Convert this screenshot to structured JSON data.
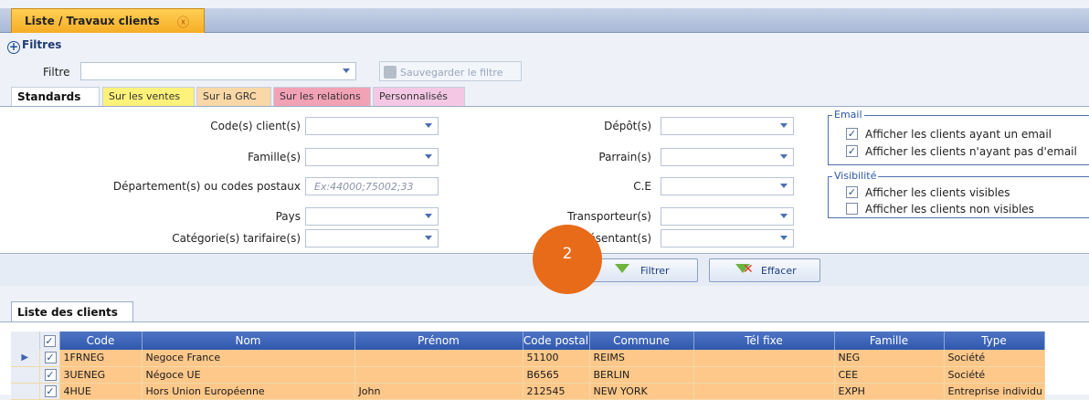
{
  "window": {
    "tab_label": "Liste / Travaux clients",
    "tab_close": "ⓧ"
  },
  "filters": {
    "title": "Filtres",
    "filter_label": "Filtre",
    "filter_value": "",
    "save_button": "Sauvegarder le filtre"
  },
  "subtabs": [
    {
      "label": "Standards",
      "color": "#ffffff"
    },
    {
      "label": "Sur les ventes",
      "color": "#fff27a"
    },
    {
      "label": "Sur la GRC",
      "color": "#f9d7a6"
    },
    {
      "label": "Sur les relations",
      "color": "#f2a2b5"
    },
    {
      "label": "Personnalisés",
      "color": "#f4c8e4"
    }
  ],
  "fields": {
    "code_client": "Code(s) client(s)",
    "famille": "Famille(s)",
    "departement": "Département(s) ou codes postaux",
    "departement_placeholder": "Ex:44000;75002;33",
    "pays": "Pays",
    "categorie": "Catégorie(s) tarifaire(s)",
    "depot": "Dépôt(s)",
    "parrain": "Parrain(s)",
    "ce": "C.E",
    "transporteur": "Transporteur(s)",
    "representant": "ésentant(s)"
  },
  "email_group": {
    "title": "Email",
    "opt1": "Afficher les clients ayant un email",
    "opt1_checked": true,
    "opt2": "Afficher les clients n'ayant pas d'email",
    "opt2_checked": true
  },
  "visibility_group": {
    "title": "Visibilité",
    "opt1": "Afficher les clients visibles",
    "opt1_checked": true,
    "opt2": "Afficher les clients non visibles",
    "opt2_checked": false
  },
  "actions": {
    "filter": "Filtrer",
    "clear": "Effacer",
    "step_badge": "2"
  },
  "list": {
    "tab_label": "Liste des clients",
    "columns": [
      "Code",
      "Nom",
      "Prénom",
      "Code postal",
      "Commune",
      "Tél fixe",
      "Famille",
      "Type"
    ],
    "rows": [
      {
        "code": "1FRNEG",
        "nom": "Negoce France",
        "prenom": "",
        "cp": "51100",
        "commune": "REIMS",
        "tel": "",
        "famille": "NEG",
        "type": "Société"
      },
      {
        "code": "3UENEG",
        "nom": "Négoce UE",
        "prenom": "",
        "cp": "B6565",
        "commune": "BERLIN",
        "tel": "",
        "famille": "CEE",
        "type": "Société"
      },
      {
        "code": "4HUE",
        "nom": "Hors Union Européenne",
        "prenom": "John",
        "cp": "212545",
        "commune": "NEW YORK",
        "tel": "",
        "famille": "EXPH",
        "type": "Entreprise individu"
      }
    ]
  },
  "colors": {
    "accent_orange": "#f6ad26",
    "header_blue": "#2f58ad",
    "row_highlight": "#fdc88a",
    "badge": "#e86b1a"
  }
}
